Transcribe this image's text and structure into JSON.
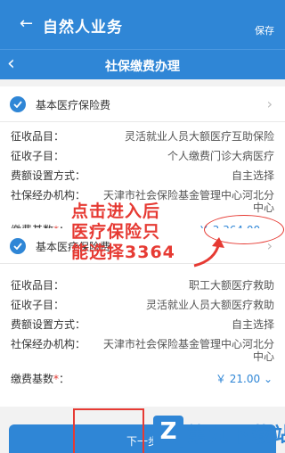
{
  "header": {
    "back_icon": "back-arrow-icon",
    "title": "自然人业务",
    "save_label": "保存"
  },
  "subheader": {
    "back_icon": "chevron-left-icon",
    "title": "社保缴费办理"
  },
  "cards": [
    {
      "title": "基本医疗保险费",
      "rows": [
        {
          "key": "征收品目：",
          "value": "灵活就业人员大额医疗互助保险"
        },
        {
          "key": "征收子目：",
          "value": "个人缴费门诊大病医疗"
        },
        {
          "key": "费额设置方式：",
          "value": "自主选择"
        },
        {
          "key": "社保经办机构：",
          "value_line1": "天津市社会保险基金管理中心河北分",
          "value_line2": "中心"
        },
        {
          "key": "缴费基数",
          "required_mark": "*",
          "colon": "：",
          "value": "￥ 3,364.00"
        }
      ]
    },
    {
      "title": "基本医疗保险费",
      "rows": [
        {
          "key": "征收品目：",
          "value": "职工大额医疗救助"
        },
        {
          "key": "征收子目：",
          "value": "灵活就业人员大额医疗救助"
        },
        {
          "key": "费额设置方式：",
          "value": "自主选择"
        },
        {
          "key": "社保经办机构：",
          "value_line1": "天津市社会保险基金管理中心河北分",
          "value_line2": "中心"
        },
        {
          "key": "缴费基数",
          "required_mark": "*",
          "colon": "：",
          "value": "￥ 21.00"
        }
      ]
    }
  ],
  "annotation": {
    "line1": "点击进入后",
    "line2": "医疗保险只",
    "line3": "能选择3364",
    "color": "#e63a33"
  },
  "footer": {
    "next_label": "下一步"
  },
  "watermark": {
    "logo_glyph": "Z",
    "text": "第九下载站"
  },
  "colors": {
    "primary": "#2f86d6",
    "annotation_red": "#e63a33"
  }
}
